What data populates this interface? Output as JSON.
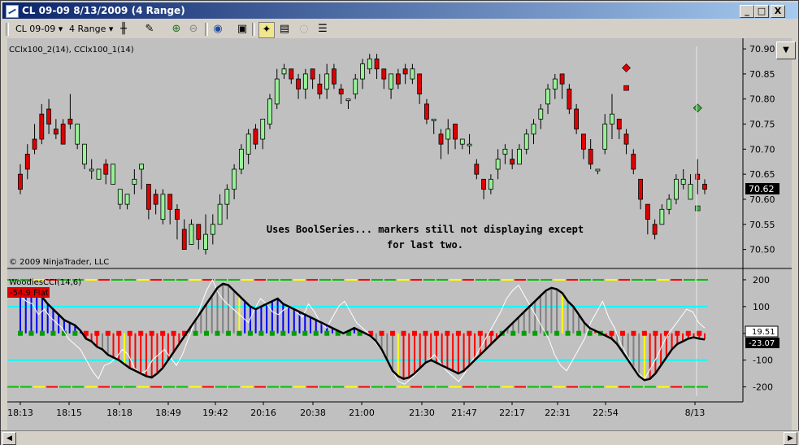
{
  "window": {
    "title": "CL 09-09  8/13/2009 (4 Range)",
    "minimize": "_",
    "maximize": "□",
    "close": "X"
  },
  "toolbar": {
    "instrument": "CL 09-09",
    "instrument_caret": "▾",
    "period": "4 Range",
    "period_caret": "▾"
  },
  "price_panel": {
    "indicator_label": "CClx100_2(14), CClx100_1(14)",
    "copyright": "© 2009 NinjaTrader, LLC",
    "annotation_line1": "Uses BoolSeries... markers still not displaying except",
    "annotation_line2": "for last two.",
    "y_ticks": [
      "70.90",
      "70.85",
      "70.80",
      "70.75",
      "70.70",
      "70.65",
      "70.60",
      "70.55",
      "70.50"
    ],
    "y_tick_values": [
      70.9,
      70.85,
      70.8,
      70.75,
      70.7,
      70.65,
      70.6,
      70.55,
      70.5
    ],
    "y_range": [
      70.475,
      70.905
    ],
    "last_price": "70.62",
    "last_price_value": 70.62
  },
  "cci_panel": {
    "label": "WoodiesCCI(14,6)",
    "status_badge": "-54.9 Flat",
    "y_ticks": [
      "200",
      "100",
      "0",
      "-100",
      "-200"
    ],
    "y_tick_values": [
      200,
      100,
      0,
      -100,
      -200
    ],
    "y_range": [
      -250,
      215
    ],
    "value_white": "19.51",
    "value_black": "-23.07"
  },
  "x_axis": {
    "labels": [
      "18:13",
      "18:15",
      "18:18",
      "18:49",
      "19:42",
      "20:16",
      "20:38",
      "21:00",
      "21:30",
      "21:47",
      "22:17",
      "22:31",
      "22:54",
      "8/13"
    ]
  },
  "colors": {
    "panel_bg": "#c0c0c0",
    "up_bar": "#98f098",
    "down_bar": "#e00000",
    "cci_blue": "#0000ff",
    "cci_red": "#ff0000",
    "cci_gray": "#808080",
    "cci_yellow": "#ffff00",
    "zero_marker": "#00a000",
    "cyan_line": "#00ffff",
    "green_line": "#00c000",
    "darkred_line": "#800000"
  },
  "chart_data": {
    "type": "candlestick",
    "bars": [
      [
        70.65,
        70.62,
        70.67,
        70.61
      ],
      [
        70.69,
        70.66,
        70.71,
        70.64
      ],
      [
        70.72,
        70.7,
        70.75,
        70.69
      ],
      [
        70.77,
        70.72,
        70.79,
        70.71
      ],
      [
        70.78,
        70.75,
        70.8,
        70.73
      ],
      [
        70.74,
        70.73,
        70.76,
        70.72
      ],
      [
        70.75,
        70.71,
        70.76,
        70.71
      ],
      [
        70.76,
        70.75,
        70.81,
        70.74
      ],
      [
        70.71,
        70.75,
        70.75,
        70.7
      ],
      [
        70.67,
        70.71,
        70.71,
        70.66
      ],
      [
        70.66,
        70.66,
        70.68,
        70.64
      ],
      [
        70.64,
        70.66,
        70.66,
        70.64
      ],
      [
        70.67,
        70.65,
        70.68,
        70.63
      ],
      [
        70.63,
        70.67,
        70.67,
        70.63
      ],
      [
        70.59,
        70.62,
        70.62,
        70.58
      ],
      [
        70.59,
        70.61,
        70.61,
        70.58
      ],
      [
        70.63,
        70.64,
        70.66,
        70.61
      ],
      [
        70.66,
        70.67,
        70.67,
        70.62
      ],
      [
        70.63,
        70.58,
        70.63,
        70.56
      ],
      [
        70.61,
        70.59,
        70.62,
        70.57
      ],
      [
        70.56,
        70.61,
        70.62,
        70.55
      ],
      [
        70.61,
        70.58,
        70.61,
        70.55
      ],
      [
        70.58,
        70.56,
        70.59,
        70.52
      ],
      [
        70.54,
        70.5,
        70.56,
        70.5
      ],
      [
        70.51,
        70.55,
        70.56,
        70.51
      ],
      [
        70.55,
        70.52,
        70.55,
        70.5
      ],
      [
        70.5,
        70.53,
        70.57,
        70.49
      ],
      [
        70.53,
        70.55,
        70.57,
        70.51
      ],
      [
        70.55,
        70.59,
        70.61,
        70.55
      ],
      [
        70.59,
        70.62,
        70.63,
        70.56
      ],
      [
        70.62,
        70.66,
        70.67,
        70.6
      ],
      [
        70.66,
        70.7,
        70.71,
        70.65
      ],
      [
        70.69,
        70.73,
        70.74,
        70.67
      ],
      [
        70.74,
        70.71,
        70.75,
        70.7
      ],
      [
        70.72,
        70.76,
        70.76,
        70.7
      ],
      [
        70.75,
        70.8,
        70.81,
        70.74
      ],
      [
        70.79,
        70.84,
        70.86,
        70.78
      ],
      [
        70.85,
        70.86,
        70.87,
        70.84
      ],
      [
        70.86,
        70.84,
        70.86,
        70.83
      ],
      [
        70.84,
        70.82,
        70.85,
        70.8
      ],
      [
        70.82,
        70.85,
        70.86,
        70.8
      ],
      [
        70.86,
        70.84,
        70.86,
        70.82
      ],
      [
        70.83,
        70.81,
        70.85,
        70.8
      ],
      [
        70.82,
        70.85,
        70.87,
        70.8
      ],
      [
        70.86,
        70.83,
        70.87,
        70.82
      ],
      [
        70.82,
        70.81,
        70.83,
        70.79
      ],
      [
        70.8,
        70.8,
        70.8,
        70.78
      ],
      [
        70.81,
        70.84,
        70.85,
        70.8
      ],
      [
        70.84,
        70.87,
        70.88,
        70.82
      ],
      [
        70.86,
        70.88,
        70.89,
        70.85
      ],
      [
        70.88,
        70.86,
        70.89,
        70.84
      ],
      [
        70.86,
        70.84,
        70.86,
        70.82
      ],
      [
        70.82,
        70.85,
        70.85,
        70.8
      ],
      [
        70.85,
        70.83,
        70.86,
        70.82
      ],
      [
        70.86,
        70.85,
        70.87,
        70.83
      ],
      [
        70.84,
        70.86,
        70.87,
        70.83
      ],
      [
        70.85,
        70.81,
        70.85,
        70.79
      ],
      [
        70.79,
        70.76,
        70.8,
        70.75
      ],
      [
        70.76,
        70.76,
        70.76,
        70.73
      ],
      [
        70.73,
        70.71,
        70.74,
        70.68
      ],
      [
        70.72,
        70.74,
        70.76,
        70.69
      ],
      [
        70.75,
        70.72,
        70.75,
        70.7
      ],
      [
        70.71,
        70.72,
        70.72,
        70.7
      ],
      [
        70.71,
        70.71,
        70.73,
        70.69
      ],
      [
        70.67,
        70.65,
        70.68,
        70.64
      ],
      [
        70.64,
        70.62,
        70.64,
        70.6
      ],
      [
        70.62,
        70.64,
        70.65,
        70.61
      ],
      [
        70.66,
        70.68,
        70.7,
        70.64
      ],
      [
        70.69,
        70.7,
        70.71,
        70.67
      ],
      [
        70.68,
        70.67,
        70.7,
        70.66
      ],
      [
        70.67,
        70.7,
        70.71,
        70.67
      ],
      [
        70.7,
        70.73,
        70.74,
        70.69
      ],
      [
        70.73,
        70.75,
        70.76,
        70.71
      ],
      [
        70.76,
        70.78,
        70.79,
        70.74
      ],
      [
        70.79,
        70.82,
        70.83,
        70.77
      ],
      [
        70.82,
        70.84,
        70.85,
        70.8
      ],
      [
        70.85,
        70.83,
        70.85,
        70.8
      ],
      [
        70.82,
        70.78,
        70.83,
        70.77
      ],
      [
        70.78,
        70.74,
        70.79,
        70.73
      ],
      [
        70.73,
        70.7,
        70.73,
        70.68
      ],
      [
        70.7,
        70.67,
        70.72,
        70.66
      ],
      [
        70.66,
        70.66,
        70.66,
        70.65
      ],
      [
        70.7,
        70.75,
        70.77,
        70.69
      ],
      [
        70.75,
        70.77,
        70.81,
        70.72
      ],
      [
        70.76,
        70.74,
        70.76,
        70.72
      ],
      [
        70.73,
        70.71,
        70.74,
        70.69
      ],
      [
        70.69,
        70.66,
        70.7,
        70.65
      ],
      [
        70.64,
        70.6,
        70.64,
        70.58
      ],
      [
        70.59,
        70.56,
        70.59,
        70.53
      ],
      [
        70.55,
        70.53,
        70.56,
        70.52
      ],
      [
        70.55,
        70.58,
        70.59,
        70.55
      ],
      [
        70.58,
        70.6,
        70.61,
        70.57
      ],
      [
        70.6,
        70.64,
        70.65,
        70.59
      ],
      [
        70.63,
        70.64,
        70.66,
        70.62
      ],
      [
        70.6,
        70.63,
        70.65,
        70.6
      ],
      [
        70.65,
        70.64,
        70.68,
        70.61
      ],
      [
        70.63,
        70.62,
        70.64,
        70.61
      ]
    ],
    "bar_fields": [
      "open",
      "close",
      "high",
      "low"
    ],
    "markers": [
      {
        "bar": 85,
        "price": 70.862,
        "shape": "diamond",
        "color": "#e00000"
      },
      {
        "bar": 85,
        "price": 70.822,
        "shape": "square",
        "color": "#e00000"
      },
      {
        "bar": 95,
        "price": 70.782,
        "shape": "diamond",
        "color": "#30b030"
      },
      {
        "bar": 95,
        "price": 70.582,
        "shape": "square",
        "color": "#30b030"
      }
    ],
    "cci_series": {
      "black": [
        165,
        160,
        150,
        140,
        135,
        110,
        90,
        70,
        50,
        40,
        30,
        10,
        -20,
        -30,
        -50,
        -60,
        -80,
        -90,
        -100,
        -115,
        -130,
        -140,
        -150,
        -160,
        -165,
        -150,
        -130,
        -100,
        -70,
        -40,
        -10,
        20,
        50,
        80,
        110,
        140,
        170,
        185,
        180,
        160,
        140,
        120,
        100,
        90,
        100,
        110,
        120,
        130,
        110,
        100,
        90,
        80,
        70,
        60,
        50,
        40,
        30,
        20,
        10,
        0,
        10,
        20,
        10,
        0,
        -10,
        -30,
        -60,
        -100,
        -140,
        -160,
        -170,
        -165,
        -150,
        -130,
        -110,
        -100,
        -110,
        -120,
        -130,
        -140,
        -150,
        -140,
        -120,
        -100,
        -80,
        -60,
        -40,
        -20,
        0,
        20,
        40,
        60,
        80,
        100,
        120,
        140,
        160,
        170,
        165,
        150,
        120,
        100,
        70,
        40,
        20,
        10,
        0,
        -10,
        -20,
        -40,
        -70,
        -100,
        -130,
        -160,
        -175,
        -170,
        -150,
        -120,
        -90,
        -60,
        -40,
        -30,
        -20,
        -15,
        -20,
        -23
      ],
      "white": [
        140,
        120,
        110,
        70,
        90,
        60,
        40,
        20,
        -20,
        -40,
        -60,
        -100,
        -140,
        -170,
        -120,
        -110,
        -90,
        -60,
        -80,
        -130,
        -150,
        -140,
        -100,
        -80,
        -60,
        -90,
        -120,
        -80,
        -20,
        40,
        100,
        160,
        200,
        150,
        120,
        100,
        80,
        60,
        40,
        90,
        130,
        110,
        80,
        70,
        90,
        100,
        80,
        60,
        110,
        80,
        40,
        20,
        60,
        100,
        120,
        80,
        40,
        20,
        0,
        -30,
        -60,
        -100,
        -140,
        -180,
        -190,
        -170,
        -150,
        -120,
        -100,
        -80,
        -110,
        -140,
        -160,
        -180,
        -150,
        -110,
        -80,
        -40,
        0,
        40,
        80,
        130,
        160,
        180,
        140,
        100,
        60,
        20,
        -20,
        -80,
        -120,
        -140,
        -100,
        -60,
        -20,
        40,
        80,
        120,
        60,
        20,
        -40,
        -80,
        -120,
        -150,
        -170,
        -130,
        -90,
        -40,
        0,
        30,
        60,
        90,
        80,
        40,
        20
      ],
      "histogram": [
        [
          "blue",
          165
        ],
        [
          "blue",
          160
        ],
        [
          "blue",
          150
        ],
        [
          "blue",
          140
        ],
        [
          "blue",
          135
        ],
        [
          "blue",
          110
        ],
        [
          "blue",
          90
        ],
        [
          "blue",
          70
        ],
        [
          "blue",
          50
        ],
        [
          "blue",
          40
        ],
        [
          "blue",
          30
        ],
        [
          "blue",
          10
        ],
        [
          "red",
          -20
        ],
        [
          "red",
          -30
        ],
        [
          "red",
          -50
        ],
        [
          "gray",
          -60
        ],
        [
          "gray",
          -80
        ],
        [
          "red",
          -90
        ],
        [
          "red",
          -100
        ],
        [
          "yellow",
          -115
        ],
        [
          "red",
          -130
        ],
        [
          "red",
          -140
        ],
        [
          "red",
          -150
        ],
        [
          "red",
          -160
        ],
        [
          "red",
          -165
        ],
        [
          "red",
          -150
        ],
        [
          "red",
          -130
        ],
        [
          "red",
          -100
        ],
        [
          "red",
          -70
        ],
        [
          "red",
          -40
        ],
        [
          "red",
          -10
        ],
        [
          "gray",
          20
        ],
        [
          "gray",
          50
        ],
        [
          "gray",
          80
        ],
        [
          "gray",
          110
        ],
        [
          "gray",
          140
        ],
        [
          "gray",
          170
        ],
        [
          "gray",
          185
        ],
        [
          "gray",
          180
        ],
        [
          "gray",
          160
        ],
        [
          "yellow",
          140
        ],
        [
          "blue",
          120
        ],
        [
          "blue",
          100
        ],
        [
          "blue",
          90
        ],
        [
          "blue",
          100
        ],
        [
          "blue",
          110
        ],
        [
          "blue",
          120
        ],
        [
          "blue",
          130
        ],
        [
          "blue",
          110
        ],
        [
          "blue",
          100
        ],
        [
          "blue",
          90
        ],
        [
          "blue",
          80
        ],
        [
          "blue",
          70
        ],
        [
          "blue",
          60
        ],
        [
          "blue",
          50
        ],
        [
          "blue",
          40
        ],
        [
          "blue",
          30
        ],
        [
          "blue",
          20
        ],
        [
          "blue",
          10
        ],
        [
          "red",
          0
        ],
        [
          "blue",
          10
        ],
        [
          "blue",
          20
        ],
        [
          "blue",
          10
        ],
        [
          "red",
          0
        ],
        [
          "red",
          -10
        ],
        [
          "gray",
          -30
        ],
        [
          "gray",
          -60
        ],
        [
          "gray",
          -100
        ],
        [
          "gray",
          -140
        ],
        [
          "yellow",
          -160
        ],
        [
          "red",
          -170
        ],
        [
          "red",
          -165
        ],
        [
          "red",
          -150
        ],
        [
          "red",
          -130
        ],
        [
          "red",
          -110
        ],
        [
          "red",
          -100
        ],
        [
          "red",
          -110
        ],
        [
          "red",
          -120
        ],
        [
          "red",
          -130
        ],
        [
          "red",
          -140
        ],
        [
          "red",
          -150
        ],
        [
          "red",
          -140
        ],
        [
          "red",
          -120
        ],
        [
          "red",
          -100
        ],
        [
          "red",
          -80
        ],
        [
          "red",
          -60
        ],
        [
          "red",
          -40
        ],
        [
          "red",
          -20
        ],
        [
          "gray",
          0
        ],
        [
          "gray",
          20
        ],
        [
          "gray",
          40
        ],
        [
          "gray",
          60
        ],
        [
          "gray",
          80
        ],
        [
          "gray",
          100
        ],
        [
          "gray",
          120
        ],
        [
          "gray",
          140
        ],
        [
          "gray",
          160
        ],
        [
          "gray",
          170
        ],
        [
          "gray",
          165
        ],
        [
          "yellow",
          150
        ],
        [
          "gray",
          120
        ],
        [
          "gray",
          100
        ],
        [
          "gray",
          70
        ],
        [
          "gray",
          40
        ],
        [
          "gray",
          20
        ],
        [
          "red",
          10
        ],
        [
          "red",
          0
        ],
        [
          "red",
          -10
        ],
        [
          "red",
          -20
        ],
        [
          "gray",
          -40
        ],
        [
          "gray",
          -70
        ],
        [
          "gray",
          -100
        ],
        [
          "gray",
          -130
        ],
        [
          "gray",
          -160
        ],
        [
          "yellow",
          -175
        ],
        [
          "red",
          -170
        ],
        [
          "red",
          -150
        ],
        [
          "red",
          -120
        ],
        [
          "red",
          -90
        ],
        [
          "red",
          -60
        ],
        [
          "red",
          -40
        ],
        [
          "red",
          -30
        ],
        [
          "red",
          -20
        ],
        [
          "red",
          -15
        ],
        [
          "red",
          -20
        ],
        [
          "red",
          -23
        ]
      ]
    }
  }
}
